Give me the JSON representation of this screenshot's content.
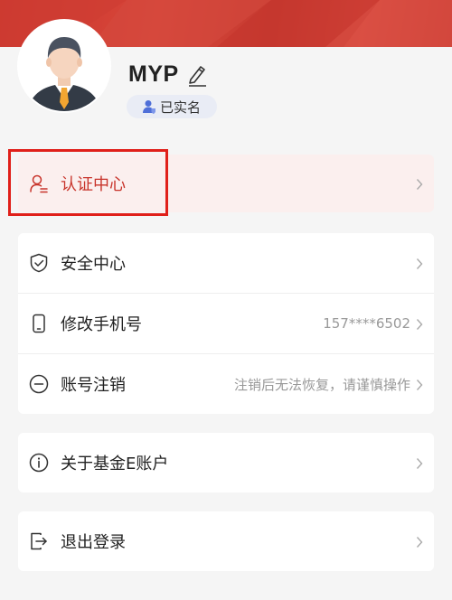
{
  "profile": {
    "username": "MYP",
    "verified_badge": "已实名"
  },
  "certification": {
    "label": "认证中心"
  },
  "security_menu": {
    "items": [
      {
        "label": "安全中心",
        "value": ""
      },
      {
        "label": "修改手机号",
        "value": "157****6502"
      },
      {
        "label": "账号注销",
        "value": "注销后无法恢复，请谨慎操作"
      }
    ]
  },
  "about": {
    "label": "关于基金E账户"
  },
  "logout": {
    "label": "退出登录"
  },
  "colors": {
    "brand_red": "#d9473b",
    "highlight_red": "#e0201a",
    "cert_label": "#c8342b",
    "badge_bg": "#e9ecf5",
    "badge_icon": "#4f6fd8"
  },
  "icons": [
    "pencil-edit-icon",
    "verified-user-icon",
    "user-cert-icon",
    "shield-check-icon",
    "phone-icon",
    "minus-circle-icon",
    "info-circle-icon",
    "logout-icon",
    "chevron-right-icon"
  ]
}
